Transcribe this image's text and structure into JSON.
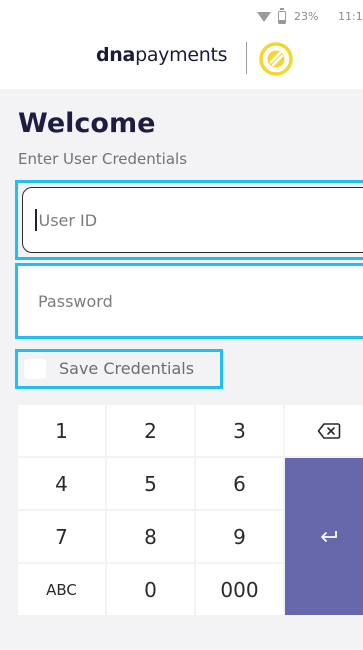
{
  "status_bar": {
    "battery": "23%",
    "time": "11:1"
  },
  "brand": {
    "bold": "dna",
    "light": "payments"
  },
  "login": {
    "title": "Welcome",
    "subtitle": "Enter User Credentials",
    "user_id_placeholder": "User ID",
    "password_placeholder": "Password",
    "save_label": "Save Credentials"
  },
  "keypad": {
    "keys": [
      "1",
      "2",
      "3",
      "4",
      "5",
      "6",
      "7",
      "8",
      "9",
      "ABC",
      "0",
      "000"
    ],
    "backspace_icon": "backspace-icon",
    "enter_icon": "enter-icon",
    "enter_color": "#6768ab"
  },
  "colors": {
    "highlight": "#21bff0",
    "title": "#1d1d42",
    "logo_yellow": "#f4d631"
  }
}
